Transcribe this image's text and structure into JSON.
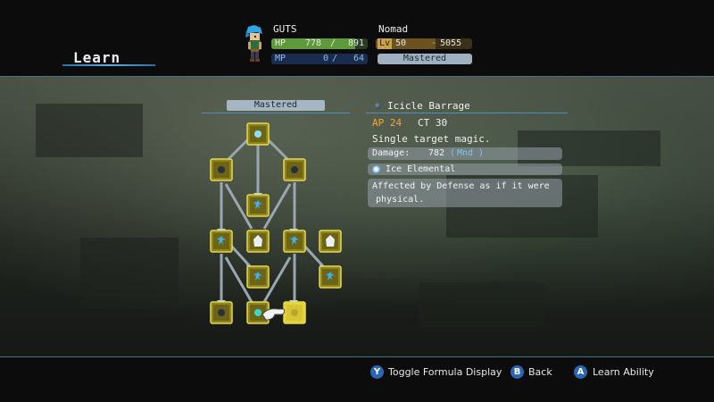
{
  "screen": {
    "title": "Learn"
  },
  "character": {
    "name": "GUTS",
    "job": "Nomad",
    "hp": {
      "label": "HP",
      "current": "778",
      "separator": "/",
      "max": "891",
      "fraction": 0.873
    },
    "mp": {
      "label": "MP",
      "current": "0",
      "separator": "/",
      "max": "64",
      "fraction": 0.0
    },
    "level": {
      "label": "Lv",
      "value": "50"
    },
    "jp": {
      "value": "5055"
    },
    "job_status": "Mastered"
  },
  "tree_panel": {
    "status": "Mastered"
  },
  "ability": {
    "name": "Icicle Barrage",
    "ap_label": "AP 24",
    "ct_label": "CT 30",
    "description": "Single target magic.",
    "damage_label": "Damage:",
    "damage_value": "782",
    "damage_stat": "Mnd",
    "element": "Ice Elemental",
    "note_line1": "Affected by Defense as if it were",
    "note_line2": "physical."
  },
  "footer": {
    "buttons": [
      {
        "glyph": "Y",
        "label": "Toggle Formula Display",
        "color": "#2a66b4"
      },
      {
        "glyph": "B",
        "label": "Back",
        "color": "#2a66b4"
      },
      {
        "glyph": "A",
        "label": "Learn Ability",
        "color": "#2a66b4"
      }
    ]
  },
  "colors": {
    "hp_fill": "#5f9a3a",
    "mp_fill": "#1f3f6e",
    "lv_fill": "#6b5320",
    "node_fill": "#c9ba35",
    "ap_text": "#f3a43a",
    "accent_line": "#4e8fbf"
  }
}
